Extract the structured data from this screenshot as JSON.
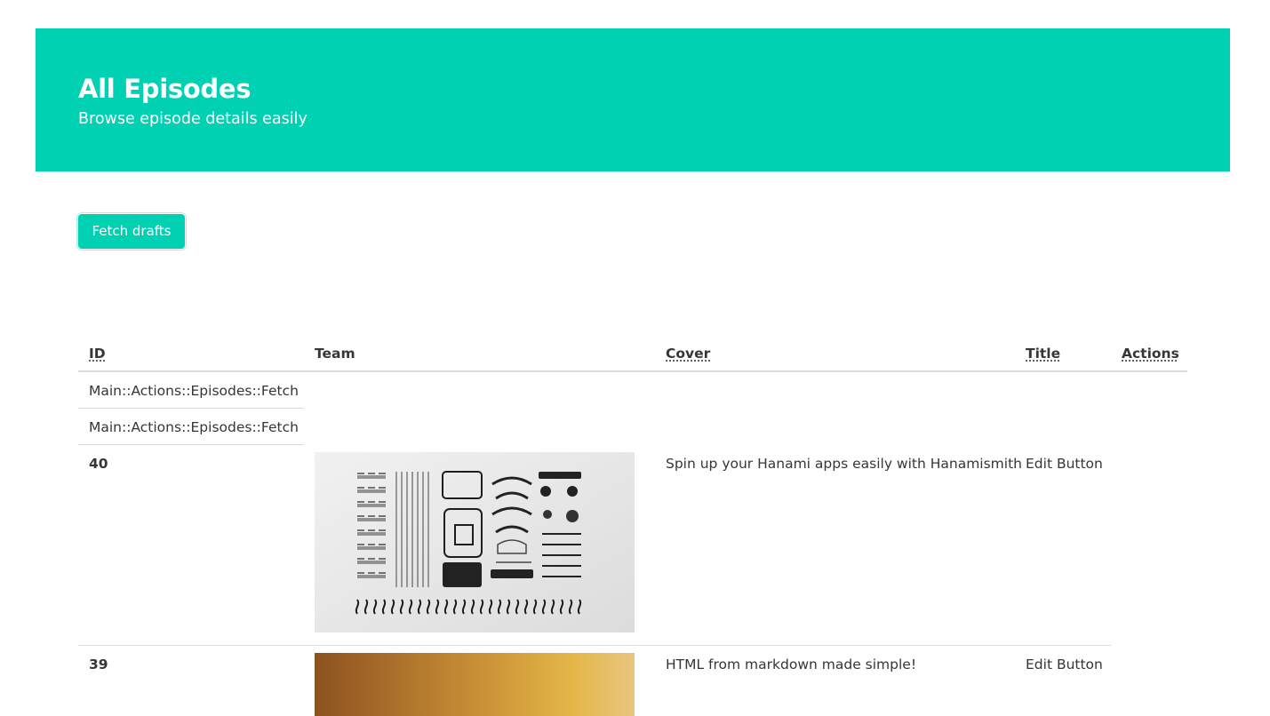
{
  "hero": {
    "title": "All Episodes",
    "subtitle": "Browse episode details easily",
    "background_color": "#00d1b2"
  },
  "toolbar": {
    "fetch_label": "Fetch drafts"
  },
  "table": {
    "columns": {
      "id": "ID",
      "team": "Team",
      "cover": "Cover",
      "title": "Title",
      "actions": "Actions"
    },
    "notice_rows": [
      "Main::Actions::Episodes::Fetch",
      "Main::Actions::Episodes::Fetch"
    ],
    "rows": [
      {
        "id": "40",
        "image": "typewriter-parts-photo",
        "cover": "Spin up your Hanami apps easily with Hanamismith",
        "title": "Edit Button"
      },
      {
        "id": "39",
        "image": "golden-gradient-photo",
        "cover": "HTML from markdown made simple!",
        "title": "Edit Button"
      }
    ]
  }
}
